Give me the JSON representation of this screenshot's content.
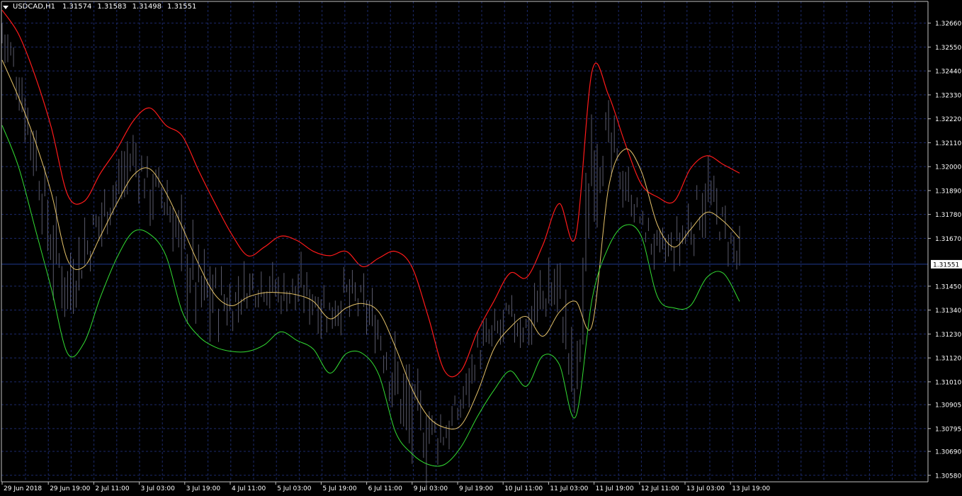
{
  "header": {
    "symbol": "USDCAD,H1",
    "open": "1.31574",
    "high": "1.31583",
    "low": "1.31498",
    "close": "1.31551"
  },
  "colors": {
    "background": "#000000",
    "grid": "#1c2a6b",
    "axis": "#c0c0c0",
    "text": "#ffffff",
    "price_bars": "#5a5a6a",
    "upper_band": "#ff1a1a",
    "middle_band": "#e6c36a",
    "lower_band": "#33dd33",
    "current_price_line": "#1f3b8f",
    "current_price_tag_bg": "#ffffff",
    "current_price_tag_text": "#000000"
  },
  "chart_data": {
    "type": "line",
    "y_ticks": [
      "1.32660",
      "1.32550",
      "1.32440",
      "1.32330",
      "1.32220",
      "1.32110",
      "1.32000",
      "1.31890",
      "1.31780",
      "1.31670",
      "1.31450",
      "1.31340",
      "1.31230",
      "1.31120",
      "1.31010",
      "1.30905",
      "1.30795",
      "1.30690",
      "1.30580"
    ],
    "ylim": [
      1.3055,
      1.3276
    ],
    "x_ticks": [
      "29 Jun 2018",
      "29 Jun 19:00",
      "2 Jul 11:00",
      "3 Jul 03:00",
      "3 Jul 19:00",
      "4 Jul 11:00",
      "5 Jul 03:00",
      "5 Jul 19:00",
      "6 Jul 11:00",
      "9 Jul 03:00",
      "9 Jul 19:00",
      "10 Jul 11:00",
      "11 Jul 03:00",
      "11 Jul 19:00",
      "12 Jul 11:00",
      "13 Jul 03:00",
      "13 Jul 19:00"
    ],
    "current_price": "1.31551",
    "grid": true,
    "series": [
      {
        "key": "upper",
        "values": [
          1.3272,
          1.3261,
          1.3242,
          1.3218,
          1.3187,
          1.3184,
          1.3197,
          1.3208,
          1.3221,
          1.3227,
          1.3219,
          1.3214,
          1.3198,
          1.3183,
          1.3169,
          1.3159,
          1.3163,
          1.3168,
          1.3166,
          1.3161,
          1.3159,
          1.3161,
          1.3154,
          1.3158,
          1.3161,
          1.3154,
          1.3131,
          1.3106,
          1.3106,
          1.3124,
          1.3138,
          1.3151,
          1.3149,
          1.3164,
          1.3183,
          1.3168,
          1.3244,
          1.3233,
          1.3211,
          1.3192,
          1.3186,
          1.3184,
          1.3199,
          1.3205,
          1.3201,
          1.3197
        ]
      },
      {
        "key": "middle",
        "values": [
          1.3249,
          1.3232,
          1.3212,
          1.3188,
          1.3157,
          1.3154,
          1.3168,
          1.3183,
          1.3196,
          1.3199,
          1.3188,
          1.3172,
          1.3155,
          1.3141,
          1.3136,
          1.314,
          1.3142,
          1.3142,
          1.3141,
          1.3138,
          1.313,
          1.3135,
          1.3137,
          1.3133,
          1.3117,
          1.3098,
          1.3085,
          1.308,
          1.3081,
          1.3096,
          1.3116,
          1.3126,
          1.3131,
          1.3122,
          1.3133,
          1.3138,
          1.3127,
          1.319,
          1.3208,
          1.3198,
          1.3173,
          1.3163,
          1.3171,
          1.3179,
          1.3175,
          1.3167
        ]
      },
      {
        "key": "lower",
        "values": [
          1.3219,
          1.32,
          1.3172,
          1.3144,
          1.3114,
          1.3119,
          1.314,
          1.3158,
          1.317,
          1.3169,
          1.3159,
          1.3133,
          1.3122,
          1.3117,
          1.3115,
          1.3115,
          1.3118,
          1.3124,
          1.312,
          1.3116,
          1.3105,
          1.3114,
          1.3114,
          1.3104,
          1.3078,
          1.3068,
          1.3063,
          1.3063,
          1.3071,
          1.3085,
          1.3097,
          1.3106,
          1.3099,
          1.3113,
          1.3109,
          1.3085,
          1.3139,
          1.3163,
          1.3173,
          1.3168,
          1.314,
          1.3135,
          1.3136,
          1.3149,
          1.3151,
          1.3138
        ]
      },
      {
        "key": "price",
        "values": [
          1.3262,
          1.324,
          1.3208,
          1.3165,
          1.3145,
          1.316,
          1.3176,
          1.319,
          1.3205,
          1.319,
          1.3185,
          1.3162,
          1.3143,
          1.314,
          1.3136,
          1.3145,
          1.3147,
          1.3142,
          1.3143,
          1.314,
          1.3133,
          1.3141,
          1.3137,
          1.3124,
          1.31,
          1.3085,
          1.3078,
          1.3077,
          1.309,
          1.3115,
          1.3122,
          1.313,
          1.3126,
          1.314,
          1.3145,
          1.309,
          1.3207,
          1.321,
          1.3192,
          1.3175,
          1.316,
          1.3162,
          1.3172,
          1.3188,
          1.3172,
          1.3155
        ]
      }
    ]
  }
}
